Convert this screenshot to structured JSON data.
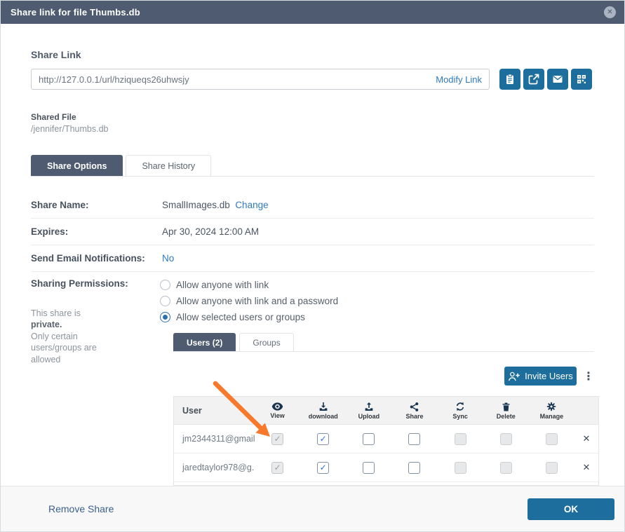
{
  "dialog": {
    "title": "Share link for file Thumbs.db"
  },
  "share_link": {
    "label": "Share Link",
    "url": "http://127.0.0.1/url/hziqueqs26uhwsjy",
    "modify_label": "Modify Link",
    "actions": [
      {
        "name": "copy-link",
        "icon": "clipboard-icon"
      },
      {
        "name": "open-link",
        "icon": "external-link-icon"
      },
      {
        "name": "email-link",
        "icon": "envelope-icon"
      },
      {
        "name": "embed-link",
        "icon": "grid-icon"
      }
    ]
  },
  "shared_file": {
    "label": "Shared File",
    "path": "/jennifer/Thumbs.db"
  },
  "tabs": [
    {
      "label": "Share Options",
      "active": true
    },
    {
      "label": "Share History",
      "active": false
    }
  ],
  "fields": {
    "share_name": {
      "label": "Share Name:",
      "value": "SmallImages.db",
      "action_label": "Change"
    },
    "expires": {
      "label": "Expires:",
      "value": "Apr 30, 2024 12:00 AM"
    },
    "email_notifications": {
      "label": "Send Email Notifications:",
      "value": "No"
    },
    "sharing_permissions": {
      "label": "Sharing Permissions:",
      "options": [
        "Allow anyone with link",
        "Allow anyone with link and a password",
        "Allow selected users or groups"
      ],
      "selected_index": 2
    }
  },
  "private_note": {
    "lines": [
      "This share is",
      "private.",
      "Only certain",
      "users/groups are",
      "allowed"
    ]
  },
  "user_group_tabs": [
    {
      "label": "Users (2)",
      "active": true
    },
    {
      "label": "Groups",
      "active": false
    }
  ],
  "invite_users": {
    "label": "Invite Users"
  },
  "users_table": {
    "user_column_label": "User",
    "permission_columns": [
      {
        "label": "View",
        "icon": "eye-icon"
      },
      {
        "label": "download",
        "icon": "download-icon"
      },
      {
        "label": "Upload",
        "icon": "upload-icon"
      },
      {
        "label": "Share",
        "icon": "share-icon"
      },
      {
        "label": "Sync",
        "icon": "sync-icon"
      },
      {
        "label": "Delete",
        "icon": "trash-icon"
      },
      {
        "label": "Manage",
        "icon": "gear-icon"
      }
    ],
    "rows": [
      {
        "user": "jm2344311@gmail....",
        "permissions": [
          "checked-disabled",
          "checked",
          "unchecked",
          "unchecked",
          "disabled",
          "disabled",
          "disabled"
        ]
      },
      {
        "user": "jaredtaylor978@g...",
        "permissions": [
          "checked-disabled",
          "checked",
          "unchecked",
          "unchecked",
          "disabled",
          "disabled",
          "disabled"
        ]
      }
    ]
  },
  "footer": {
    "remove_share_label": "Remove Share",
    "ok_label": "OK"
  },
  "annotation": {
    "type": "arrow",
    "color": "#f8792b"
  },
  "colors": {
    "header_bg": "#4e5b70",
    "primary_button": "#1d6e9d",
    "link_blue": "#2f7bbf",
    "arrow_orange": "#f8792b"
  }
}
